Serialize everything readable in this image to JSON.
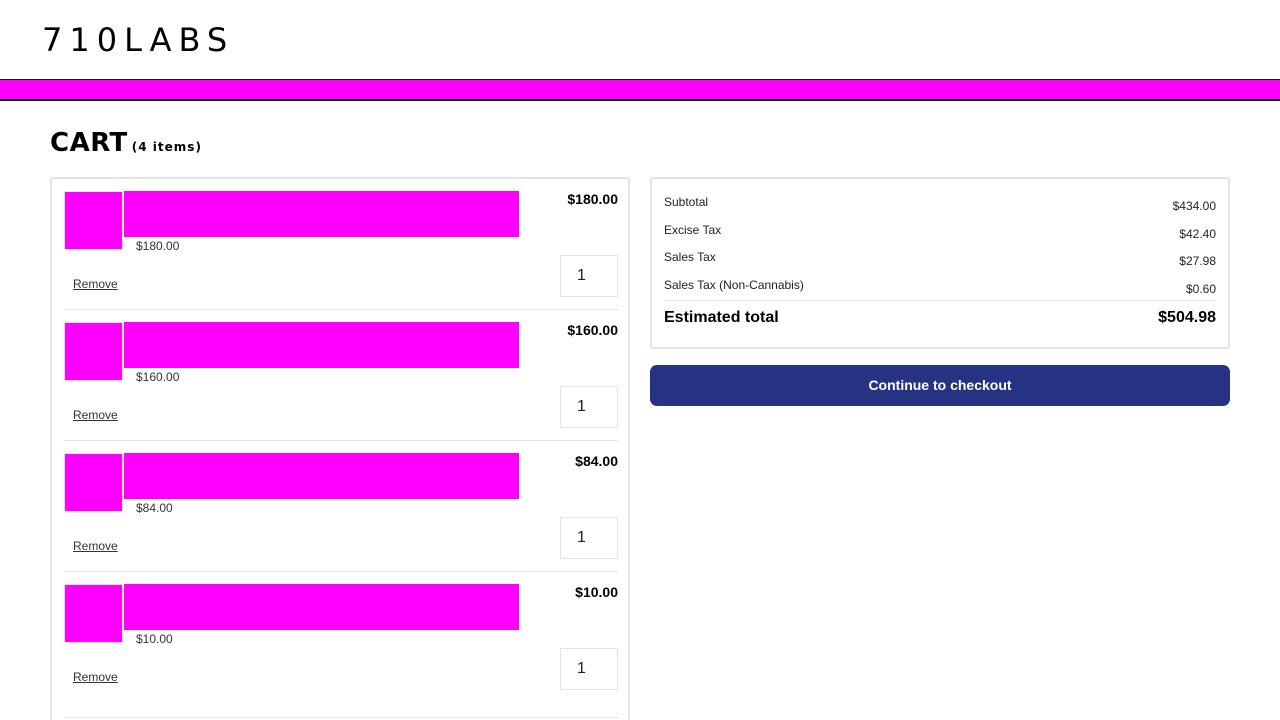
{
  "header": {
    "logo_text": "710LABS",
    "accent_color": "#ff00ff"
  },
  "cart": {
    "title": "CART",
    "count_label": "(4 items)",
    "items": [
      {
        "unit_price": "$180.00",
        "line_total": "$180.00",
        "quantity": "1",
        "remove_label": "Remove"
      },
      {
        "unit_price": "$160.00",
        "line_total": "$160.00",
        "quantity": "1",
        "remove_label": "Remove"
      },
      {
        "unit_price": "$84.00",
        "line_total": "$84.00",
        "quantity": "1",
        "remove_label": "Remove"
      },
      {
        "unit_price": "$10.00",
        "line_total": "$10.00",
        "quantity": "1",
        "remove_label": "Remove"
      }
    ]
  },
  "summary": {
    "rows": [
      {
        "label": "Subtotal",
        "value": "$434.00"
      },
      {
        "label": "Excise Tax",
        "value": "$42.40"
      },
      {
        "label": "Sales Tax",
        "value": "$27.98"
      },
      {
        "label": "Sales Tax (Non-Cannabis)",
        "value": "$0.60"
      }
    ],
    "total_label": "Estimated total",
    "total_value": "$504.98"
  },
  "checkout": {
    "button_label": "Continue to checkout",
    "button_color": "#253382"
  }
}
